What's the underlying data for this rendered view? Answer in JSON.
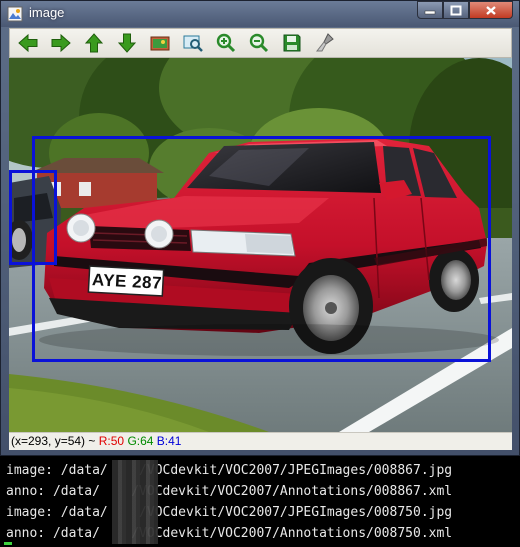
{
  "window": {
    "title": "image",
    "buttons": [
      "minimize",
      "maximize",
      "close"
    ]
  },
  "toolbar": {
    "tools": [
      {
        "name": "pan-left",
        "icon": "arrow-left-icon",
        "color": "#3a9a1e"
      },
      {
        "name": "pan-right",
        "icon": "arrow-right-icon",
        "color": "#3a9a1e"
      },
      {
        "name": "pan-up",
        "icon": "arrow-up-icon",
        "color": "#3a9a1e"
      },
      {
        "name": "pan-down",
        "icon": "arrow-down-icon",
        "color": "#3a9a1e"
      },
      {
        "name": "zoom-reset",
        "icon": "image-icon",
        "color": "#a0522d"
      },
      {
        "name": "zoom-region",
        "icon": "zoom-region-icon",
        "color": "#2a7a9a"
      },
      {
        "name": "zoom-in",
        "icon": "zoom-in-icon",
        "color": "#2a8a2a"
      },
      {
        "name": "zoom-out",
        "icon": "zoom-out-icon",
        "color": "#2a8a2a"
      },
      {
        "name": "save",
        "icon": "save-icon",
        "color": "#2a8a2a"
      },
      {
        "name": "properties",
        "icon": "brush-icon",
        "color": "#8a8a8a"
      }
    ]
  },
  "image": {
    "plate_text": "AYE 287",
    "bbox_color": "#0a12d8"
  },
  "status": {
    "coords": "(x=293, y=54) ~ ",
    "r": "R:50",
    "g": "G:64",
    "b": "B:41"
  },
  "terminal": {
    "lines": [
      "image: /data/    /VOCdevkit/VOC2007/JPEGImages/008867.jpg",
      "anno: /data/    /VOCdevkit/VOC2007/Annotations/008867.xml",
      "image: /data/    /VOCdevkit/VOC2007/JPEGImages/008750.jpg",
      "anno: /data/    /VOCdevkit/VOC2007/Annotations/008750.xml"
    ]
  }
}
